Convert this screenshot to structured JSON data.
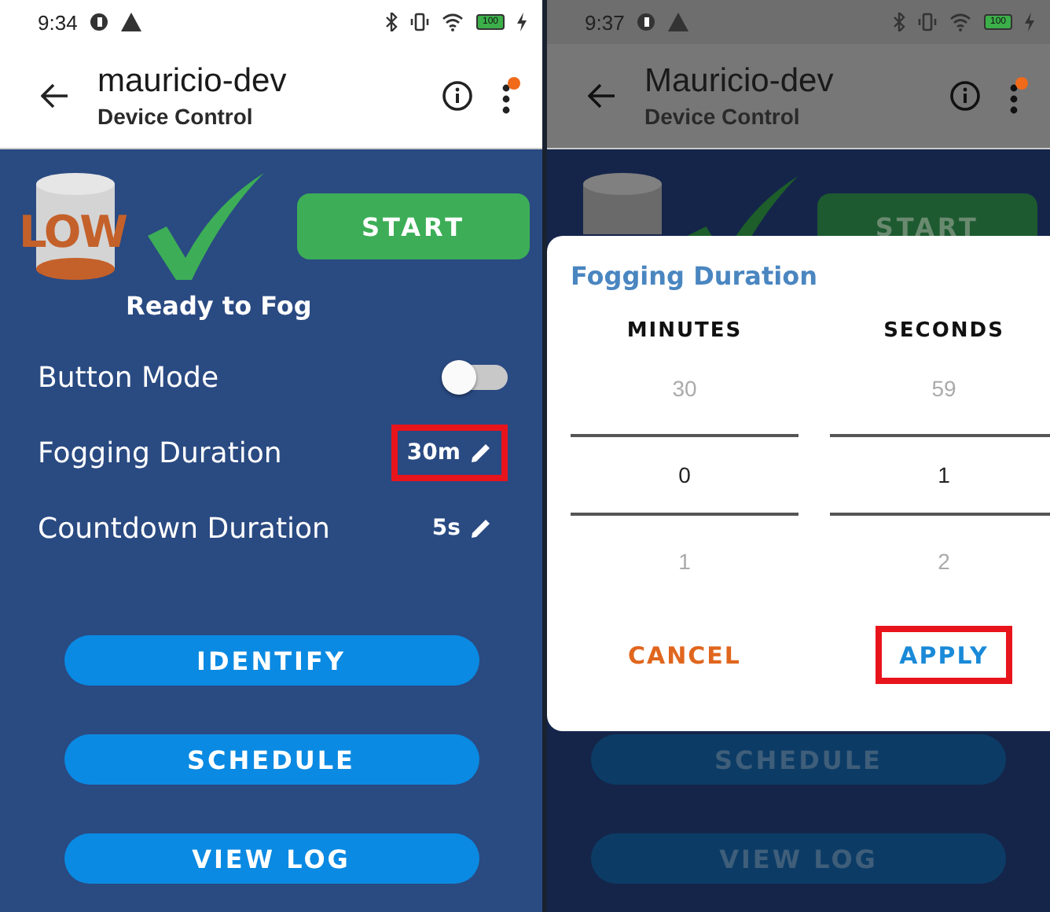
{
  "screens": [
    {
      "dimmed": false,
      "status_bar": {
        "time": "9:34",
        "battery": "100"
      },
      "header": {
        "title": "mauricio-dev",
        "subtitle": "Device Control",
        "notification": true
      },
      "tank_label": "LOW",
      "start_button": "START",
      "status_text": "Ready to Fog",
      "settings": [
        {
          "kind": "toggle",
          "label": "Button Mode",
          "on": false
        },
        {
          "kind": "value",
          "label": "Fogging Duration",
          "value": "30m",
          "highlighted": true
        },
        {
          "kind": "value",
          "label": "Countdown Duration",
          "value": "5s",
          "highlighted": false
        }
      ],
      "buttons": [
        "IDENTIFY",
        "SCHEDULE",
        "VIEW LOG"
      ]
    },
    {
      "dimmed": true,
      "status_bar": {
        "time": "9:37",
        "battery": "100"
      },
      "header": {
        "title": "Mauricio-dev",
        "subtitle": "Device Control",
        "notification": true
      },
      "start_button": "START",
      "buttons": [
        "SCHEDULE",
        "VIEW LOG"
      ],
      "dialog": {
        "title": "Fogging Duration",
        "pickers": [
          {
            "label": "MINUTES",
            "items": [
              {
                "value": "30",
                "selected": false
              },
              {
                "value": "0",
                "selected": true
              },
              {
                "value": "1",
                "selected": false
              }
            ]
          },
          {
            "label": "SECONDS",
            "items": [
              {
                "value": "59",
                "selected": false
              },
              {
                "value": "1",
                "selected": true
              },
              {
                "value": "2",
                "selected": false
              }
            ]
          }
        ],
        "actions": [
          {
            "label": "CANCEL",
            "kind": "cancel",
            "highlighted": false
          },
          {
            "label": "APPLY",
            "kind": "confirm",
            "highlighted": true
          }
        ]
      }
    }
  ]
}
